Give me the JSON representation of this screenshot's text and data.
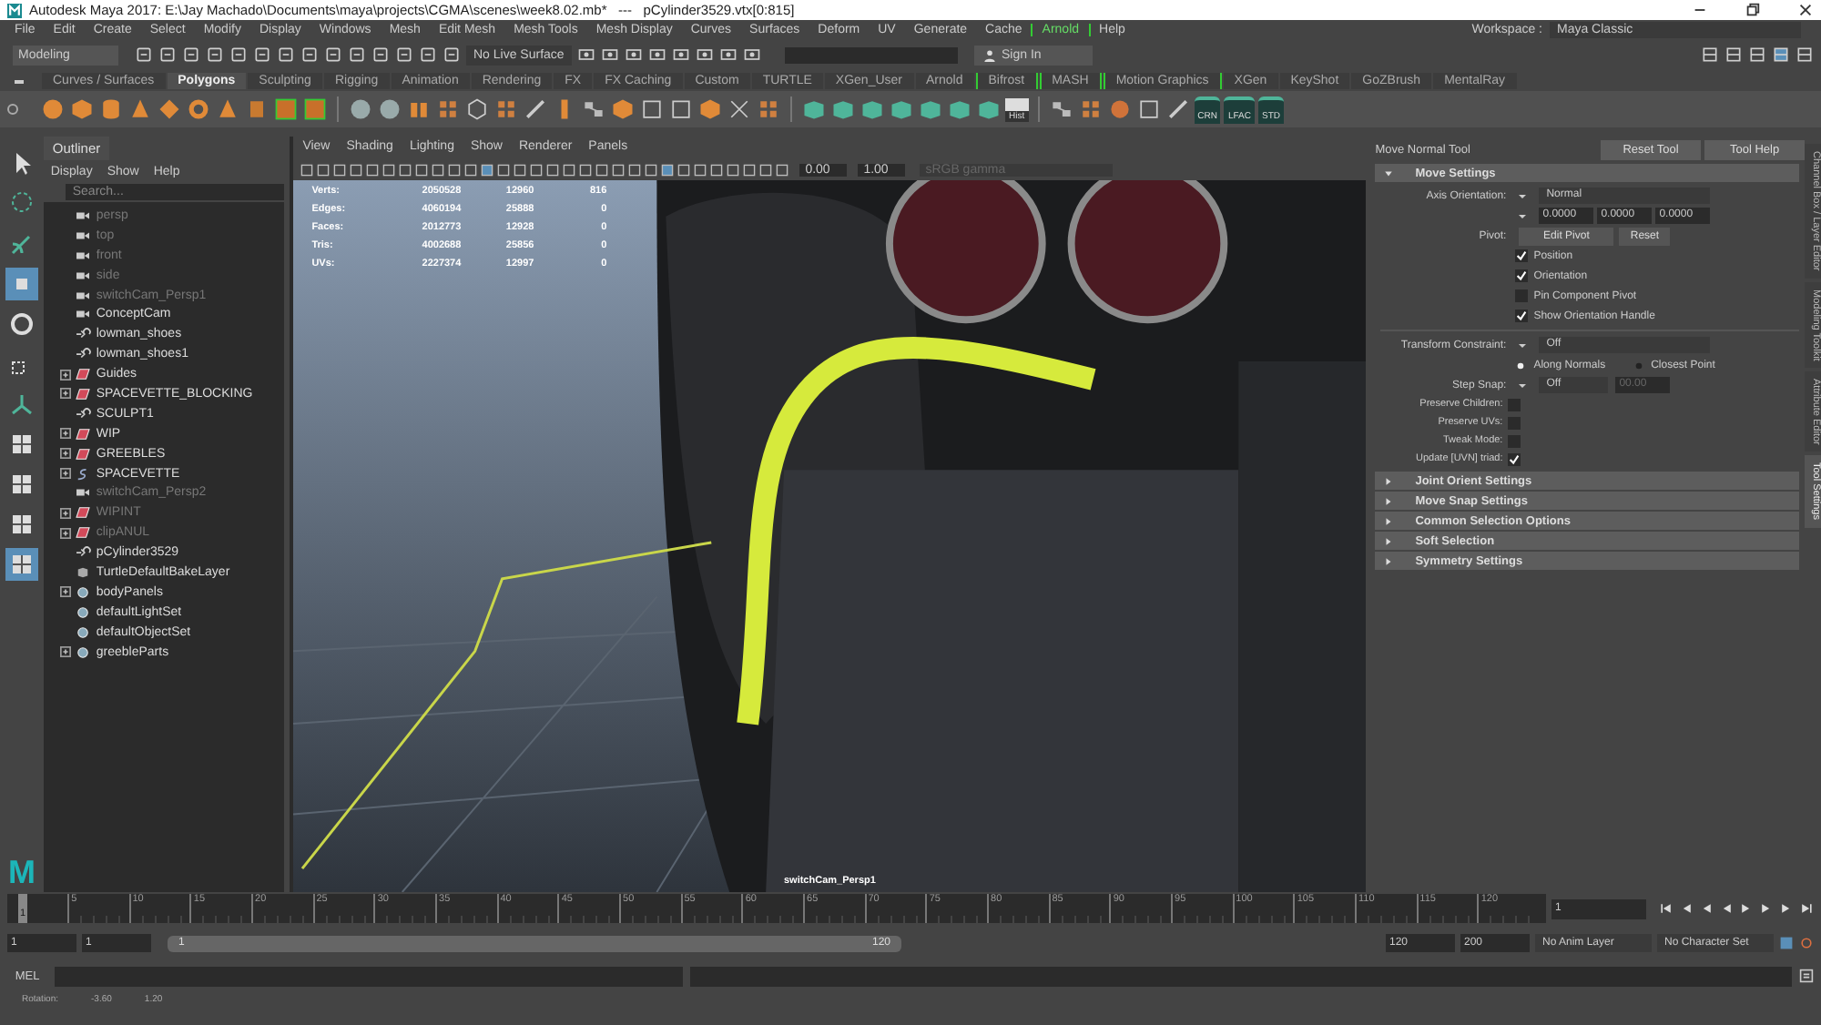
{
  "window": {
    "title": "Autodesk Maya 2017: E:\\Jay Machado\\Documents\\maya\\projects\\CGMA\\scenes\\week8.02.mb*   ---   pCylinder3529.vtx[0:815]"
  },
  "menu_bar": [
    {
      "label": "File",
      "bracketed": false
    },
    {
      "label": "Edit",
      "bracketed": false
    },
    {
      "label": "Create",
      "bracketed": false
    },
    {
      "label": "Select",
      "bracketed": false
    },
    {
      "label": "Modify",
      "bracketed": false
    },
    {
      "label": "Display",
      "bracketed": false
    },
    {
      "label": "Windows",
      "bracketed": false
    },
    {
      "label": "Mesh",
      "bracketed": false
    },
    {
      "label": "Edit Mesh",
      "bracketed": false
    },
    {
      "label": "Mesh Tools",
      "bracketed": false
    },
    {
      "label": "Mesh Display",
      "bracketed": false
    },
    {
      "label": "Curves",
      "bracketed": false
    },
    {
      "label": "Surfaces",
      "bracketed": false
    },
    {
      "label": "Deform",
      "bracketed": false
    },
    {
      "label": "UV",
      "bracketed": false
    },
    {
      "label": "Generate",
      "bracketed": false
    },
    {
      "label": "Cache",
      "bracketed": false
    },
    {
      "label": "Arnold",
      "bracketed": true
    },
    {
      "label": "Help",
      "bracketed": false
    }
  ],
  "workspace": {
    "label": "Workspace :",
    "value": "Maya Classic"
  },
  "status_line": {
    "mode": "Modeling",
    "live_surface": "No Live Surface",
    "sign_in": "Sign In"
  },
  "shelf": {
    "tabs": [
      {
        "label": "Curves / Surfaces",
        "selected": false,
        "bracketed": false
      },
      {
        "label": "Polygons",
        "selected": true,
        "bracketed": false
      },
      {
        "label": "Sculpting",
        "selected": false,
        "bracketed": false
      },
      {
        "label": "Rigging",
        "selected": false,
        "bracketed": false
      },
      {
        "label": "Animation",
        "selected": false,
        "bracketed": false
      },
      {
        "label": "Rendering",
        "selected": false,
        "bracketed": false
      },
      {
        "label": "FX",
        "selected": false,
        "bracketed": false
      },
      {
        "label": "FX Caching",
        "selected": false,
        "bracketed": false
      },
      {
        "label": "Custom",
        "selected": false,
        "bracketed": false
      },
      {
        "label": "TURTLE",
        "selected": false,
        "bracketed": false
      },
      {
        "label": "XGen_User",
        "selected": false,
        "bracketed": false
      },
      {
        "label": "Arnold",
        "selected": false,
        "bracketed": false
      },
      {
        "label": "Bifrost",
        "selected": false,
        "bracketed": true
      },
      {
        "label": "MASH",
        "selected": false,
        "bracketed": true
      },
      {
        "label": "Motion Graphics",
        "selected": false,
        "bracketed": true
      },
      {
        "label": "XGen",
        "selected": false,
        "bracketed": false
      },
      {
        "label": "KeyShot",
        "selected": false,
        "bracketed": false
      },
      {
        "label": "GoZBrush",
        "selected": false,
        "bracketed": false
      },
      {
        "label": "MentalRay",
        "selected": false,
        "bracketed": false
      }
    ],
    "hist_button": "Hist",
    "preset_buttons": [
      "CRN",
      "LFAC",
      "STD"
    ]
  },
  "logo": "M",
  "outliner": {
    "title": "Outliner",
    "menus": [
      "Display",
      "Show",
      "Help"
    ],
    "search": {
      "placeholder": "Search..."
    },
    "items": [
      {
        "label": "persp",
        "kind": "camera",
        "dimmed": true,
        "expandable": false
      },
      {
        "label": "top",
        "kind": "camera",
        "dimmed": true,
        "expandable": false
      },
      {
        "label": "front",
        "kind": "camera",
        "dimmed": true,
        "expandable": false
      },
      {
        "label": "side",
        "kind": "camera",
        "dimmed": true,
        "expandable": false
      },
      {
        "label": "switchCam_Persp1",
        "kind": "camera",
        "dimmed": true,
        "expandable": false
      },
      {
        "label": "ConceptCam",
        "kind": "camera",
        "dimmed": false,
        "expandable": false
      },
      {
        "label": "lowman_shoes",
        "kind": "transform",
        "dimmed": false,
        "expandable": false
      },
      {
        "label": "lowman_shoes1",
        "kind": "transform",
        "dimmed": false,
        "expandable": false
      },
      {
        "label": "Guides",
        "kind": "layer",
        "dimmed": false,
        "expandable": true
      },
      {
        "label": "SPACEVETTE_BLOCKING",
        "kind": "layer",
        "dimmed": false,
        "expandable": true
      },
      {
        "label": "SCULPT1",
        "kind": "transform",
        "dimmed": false,
        "expandable": false
      },
      {
        "label": "WIP",
        "kind": "layer",
        "dimmed": false,
        "expandable": true
      },
      {
        "label": "GREEBLES",
        "kind": "layer",
        "dimmed": false,
        "expandable": true
      },
      {
        "label": "SPACEVETTE",
        "kind": "curve",
        "dimmed": false,
        "expandable": true
      },
      {
        "label": "switchCam_Persp2",
        "kind": "camera",
        "dimmed": true,
        "expandable": false
      },
      {
        "label": "WIPINT",
        "kind": "layer",
        "dimmed": true,
        "expandable": true
      },
      {
        "label": "clipANUL",
        "kind": "layer",
        "dimmed": true,
        "expandable": true
      },
      {
        "label": "pCylinder3529",
        "kind": "transform",
        "dimmed": false,
        "expandable": false
      },
      {
        "label": "TurtleDefaultBakeLayer",
        "kind": "bake",
        "dimmed": false,
        "expandable": false
      },
      {
        "label": "bodyPanels",
        "kind": "set",
        "dimmed": false,
        "expandable": true
      },
      {
        "label": "defaultLightSet",
        "kind": "set",
        "dimmed": false,
        "expandable": false
      },
      {
        "label": "defaultObjectSet",
        "kind": "set",
        "dimmed": false,
        "expandable": false
      },
      {
        "label": "greebleParts",
        "kind": "set",
        "dimmed": false,
        "expandable": true
      }
    ]
  },
  "viewport": {
    "menus": [
      "View",
      "Shading",
      "Lighting",
      "Show",
      "Renderer",
      "Panels"
    ],
    "exposure": "0.00",
    "gamma": "1.00",
    "color_space": "sRGB gamma",
    "hud": [
      {
        "label": "Verts:",
        "values": [
          "2050528",
          "12960",
          "816"
        ]
      },
      {
        "label": "Edges:",
        "values": [
          "4060194",
          "25888",
          "0"
        ]
      },
      {
        "label": "Faces:",
        "values": [
          "2012773",
          "12928",
          "0"
        ]
      },
      {
        "label": "Tris:",
        "values": [
          "4002688",
          "25856",
          "0"
        ]
      },
      {
        "label": "UVs:",
        "values": [
          "2227374",
          "12997",
          "0"
        ]
      }
    ],
    "camera": "switchCam_Persp1"
  },
  "tool_settings": {
    "title": "Move Normal Tool",
    "buttons": [
      "Reset Tool",
      "Tool Help"
    ],
    "sections": [
      {
        "label": "Move Settings",
        "expanded": true
      },
      {
        "label": "Joint Orient Settings",
        "expanded": false
      },
      {
        "label": "Move Snap Settings",
        "expanded": false
      },
      {
        "label": "Common Selection Options",
        "expanded": false
      },
      {
        "label": "Soft Selection",
        "expanded": false
      },
      {
        "label": "Symmetry Settings",
        "expanded": false
      }
    ],
    "move_settings": {
      "axis_orientation": {
        "label": "Axis Orientation:",
        "value": "Normal"
      },
      "axis_values": [
        "0.0000",
        "0.0000",
        "0.0000"
      ],
      "pivot": {
        "label": "Pivot:",
        "buttons": [
          "Edit Pivot",
          "Reset"
        ]
      },
      "pivot_options": [
        {
          "label": "Position",
          "checked": true
        },
        {
          "label": "Orientation",
          "checked": true
        },
        {
          "label": "Pin Component Pivot",
          "checked": false
        },
        {
          "label": "Show Orientation Handle",
          "checked": true
        }
      ],
      "transform_constraint": {
        "label": "Transform Constraint:",
        "value": "Off"
      },
      "constraint_modes": [
        {
          "label": "Along Normals",
          "selected": true
        },
        {
          "label": "Closest Point",
          "selected": false
        }
      ],
      "step_snap": {
        "label": "Step Snap:",
        "value": "Off",
        "amount": "00.00"
      },
      "options": [
        {
          "label": "Preserve Children:",
          "checked": false
        },
        {
          "label": "Preserve UVs:",
          "checked": false
        },
        {
          "label": "Tweak Mode:",
          "checked": false
        },
        {
          "label": "Update [UVN] triad:",
          "checked": true
        }
      ]
    }
  },
  "side_tabs": [
    {
      "label": "Channel Box / Layer Editor",
      "selected": false
    },
    {
      "label": "Modeling Toolkit",
      "selected": false
    },
    {
      "label": "Attribute Editor",
      "selected": false
    },
    {
      "label": "Tool Settings",
      "selected": true
    }
  ],
  "timeline": {
    "current_frame": "1",
    "level": 0,
    "ticks": [
      "5",
      "10",
      "15",
      "20",
      "25",
      "30",
      "35",
      "40",
      "45",
      "50",
      "55",
      "60",
      "65",
      "70",
      "75",
      "80",
      "85",
      "90",
      "95",
      "100",
      "105",
      "110",
      "115",
      "120"
    ],
    "frame_field": "1"
  },
  "range": {
    "start": "1",
    "playback_start": "1",
    "slider_start": "1",
    "slider_end": "120",
    "playback_end": "120",
    "end": "200",
    "anim_layer": "No Anim Layer",
    "character_set": "No Character Set"
  },
  "command_line": {
    "label": "MEL"
  },
  "help_line": {
    "label": "Rotation:",
    "values": [
      "-3.60",
      "1.20"
    ]
  }
}
